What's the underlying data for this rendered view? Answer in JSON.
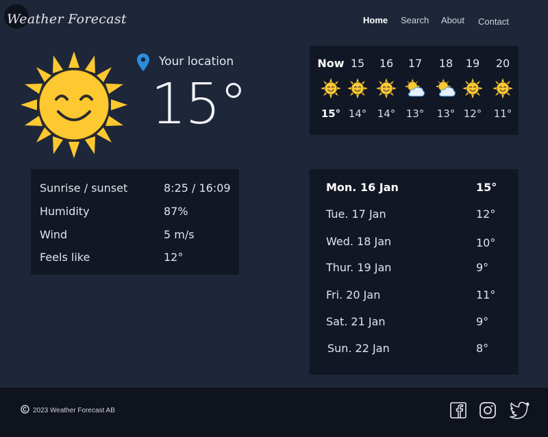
{
  "header": {
    "logo": "Weather Forecast",
    "nav": [
      {
        "label": "Home",
        "active": true
      },
      {
        "label": "Search",
        "active": false
      },
      {
        "label": "About",
        "active": false
      },
      {
        "label": "Contact",
        "active": false
      }
    ]
  },
  "current": {
    "icon": "smiling-sun-icon",
    "location_icon": "location-pin-icon",
    "location": "Your location",
    "temperature": "15°"
  },
  "details": [
    {
      "label": "Sunrise / sunset",
      "value": "8:25 / 16:09"
    },
    {
      "label": "Humidity",
      "value": "87%"
    },
    {
      "label": "Wind",
      "value": "5 m/s"
    },
    {
      "label": "Feels like",
      "value": "12°"
    }
  ],
  "hourly": [
    {
      "label": "Now",
      "icon": "sun-icon",
      "temp": "15°"
    },
    {
      "label": "15",
      "icon": "sun-icon",
      "temp": "14°"
    },
    {
      "label": "16",
      "icon": "sun-icon",
      "temp": "14°"
    },
    {
      "label": "17",
      "icon": "sun-cloud-icon",
      "temp": "13°"
    },
    {
      "label": "18",
      "icon": "sun-cloud-icon",
      "temp": "13°"
    },
    {
      "label": "19",
      "icon": "sun-icon",
      "temp": "12°"
    },
    {
      "label": "20",
      "icon": "sun-icon",
      "temp": "11°"
    }
  ],
  "daily": [
    {
      "day": "Mon. 16 Jan",
      "temp": "15°"
    },
    {
      "day": "Tue. 17 Jan",
      "temp": "12°"
    },
    {
      "day": "Wed. 18 Jan",
      "temp": "10°"
    },
    {
      "day": "Thur. 19 Jan",
      "temp": "9°"
    },
    {
      "day": "Fri. 20 Jan",
      "temp": "11°"
    },
    {
      "day": "Sat. 21 Jan",
      "temp": "9°"
    },
    {
      "day": "Sun. 22 Jan",
      "temp": "8°"
    }
  ],
  "footer": {
    "copyright": "2023 Weather Forecast AB",
    "social": [
      "facebook-icon",
      "instagram-icon",
      "twitter-icon"
    ]
  },
  "colors": {
    "background": "#1e2639",
    "panel": "#121725",
    "footer": "#0f131d",
    "sun": "#fdc830",
    "pin": "#2a8ee0"
  }
}
